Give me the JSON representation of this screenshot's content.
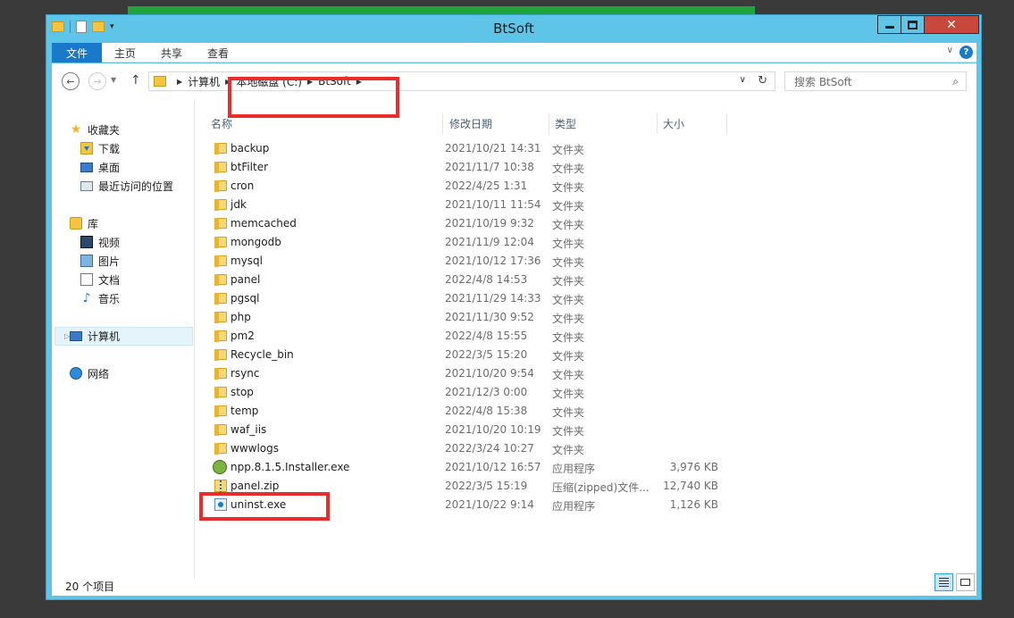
{
  "window": {
    "title": "BtSoft"
  },
  "ribbon": {
    "tabs": [
      "文件",
      "主页",
      "共享",
      "查看"
    ]
  },
  "address": {
    "crumbs": [
      "计算机",
      "本地磁盘 (C:)",
      "BtSoft"
    ]
  },
  "search": {
    "placeholder": "搜索 BtSoft"
  },
  "nav": {
    "favorites": {
      "label": "收藏夹",
      "items": [
        "下载",
        "桌面",
        "最近访问的位置"
      ]
    },
    "libraries": {
      "label": "库",
      "items": [
        "视频",
        "图片",
        "文档",
        "音乐"
      ]
    },
    "computer": "计算机",
    "network": "网络"
  },
  "columns": {
    "name": "名称",
    "date": "修改日期",
    "type": "类型",
    "size": "大小"
  },
  "files": [
    {
      "name": "backup",
      "date": "2021/10/21 14:31",
      "type": "文件夹",
      "size": "",
      "kind": "folder"
    },
    {
      "name": "btFilter",
      "date": "2021/11/7 10:38",
      "type": "文件夹",
      "size": "",
      "kind": "folder"
    },
    {
      "name": "cron",
      "date": "2022/4/25 1:31",
      "type": "文件夹",
      "size": "",
      "kind": "folder"
    },
    {
      "name": "jdk",
      "date": "2021/10/11 11:54",
      "type": "文件夹",
      "size": "",
      "kind": "folder"
    },
    {
      "name": "memcached",
      "date": "2021/10/19 9:32",
      "type": "文件夹",
      "size": "",
      "kind": "folder"
    },
    {
      "name": "mongodb",
      "date": "2021/11/9 12:04",
      "type": "文件夹",
      "size": "",
      "kind": "folder"
    },
    {
      "name": "mysql",
      "date": "2021/10/12 17:36",
      "type": "文件夹",
      "size": "",
      "kind": "folder"
    },
    {
      "name": "panel",
      "date": "2022/4/8 14:53",
      "type": "文件夹",
      "size": "",
      "kind": "folder"
    },
    {
      "name": "pgsql",
      "date": "2021/11/29 14:33",
      "type": "文件夹",
      "size": "",
      "kind": "folder"
    },
    {
      "name": "php",
      "date": "2021/11/30 9:52",
      "type": "文件夹",
      "size": "",
      "kind": "folder"
    },
    {
      "name": "pm2",
      "date": "2022/4/8 15:55",
      "type": "文件夹",
      "size": "",
      "kind": "folder"
    },
    {
      "name": "Recycle_bin",
      "date": "2022/3/5 15:20",
      "type": "文件夹",
      "size": "",
      "kind": "folder"
    },
    {
      "name": "rsync",
      "date": "2021/10/20 9:54",
      "type": "文件夹",
      "size": "",
      "kind": "folder"
    },
    {
      "name": "stop",
      "date": "2021/12/3 0:00",
      "type": "文件夹",
      "size": "",
      "kind": "folder"
    },
    {
      "name": "temp",
      "date": "2022/4/8 15:38",
      "type": "文件夹",
      "size": "",
      "kind": "folder"
    },
    {
      "name": "waf_iis",
      "date": "2021/10/20 10:19",
      "type": "文件夹",
      "size": "",
      "kind": "folder"
    },
    {
      "name": "wwwlogs",
      "date": "2022/3/24 10:27",
      "type": "文件夹",
      "size": "",
      "kind": "folder"
    },
    {
      "name": "npp.8.1.5.Installer.exe",
      "date": "2021/10/12 16:57",
      "type": "应用程序",
      "size": "3,976 KB",
      "kind": "exe"
    },
    {
      "name": "panel.zip",
      "date": "2022/3/5 15:19",
      "type": "压缩(zipped)文件...",
      "size": "12,740 KB",
      "kind": "zip"
    },
    {
      "name": "uninst.exe",
      "date": "2021/10/22 9:14",
      "type": "应用程序",
      "size": "1,126 KB",
      "kind": "uninst"
    }
  ],
  "status": {
    "count": "20 个项目"
  },
  "colors": {
    "highlight": "#ee2b2b",
    "titlebar": "#5ec4e8",
    "file_tab": "#1979ca"
  }
}
